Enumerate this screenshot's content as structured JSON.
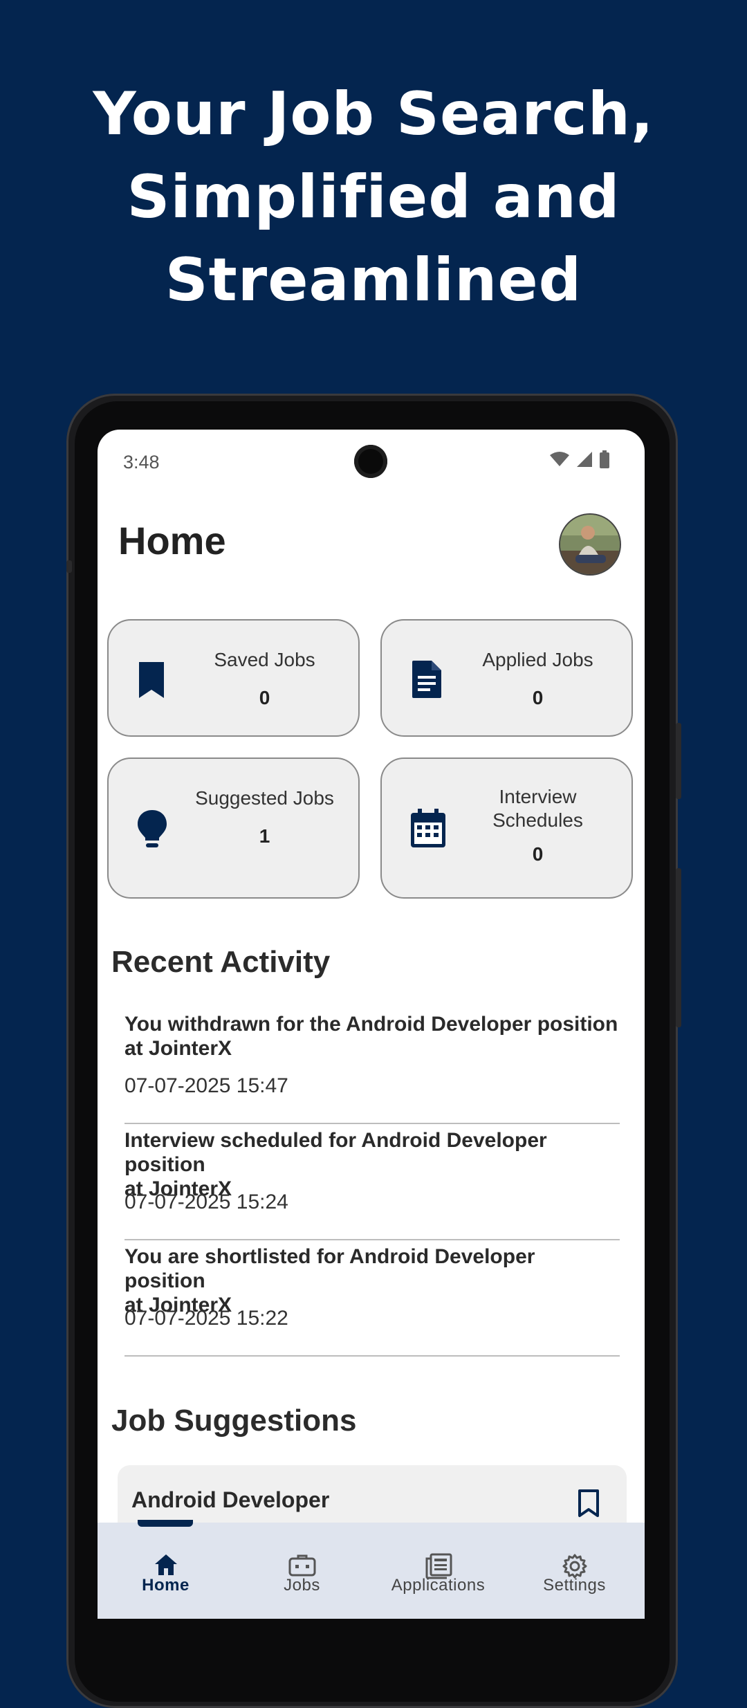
{
  "headline": {
    "line1": "Your Job Search,",
    "line2": "Simplified and",
    "line3": "Streamlined"
  },
  "status_bar": {
    "time": "3:48",
    "icons": [
      "wifi-icon",
      "signal-icon",
      "battery-icon"
    ]
  },
  "page": {
    "title": "Home"
  },
  "stats": [
    {
      "label": "Saved Jobs",
      "count": "0",
      "icon": "bookmark-icon"
    },
    {
      "label": "Applied Jobs",
      "count": "0",
      "icon": "document-icon"
    },
    {
      "label": "Suggested Jobs",
      "count": "1",
      "icon": "lightbulb-icon"
    },
    {
      "label": "Interview Schedules",
      "label_line1": "Interview",
      "label_line2": "Schedules",
      "count": "0",
      "icon": "calendar-icon"
    }
  ],
  "recent_activity": {
    "title": "Recent Activity",
    "items": [
      {
        "line1": "You withdrawn for the Android Developer position",
        "line2": "at JointerX",
        "timestamp": "07-07-2025 15:47"
      },
      {
        "line1": "Interview scheduled for Android Developer position",
        "line2": "at JointerX",
        "timestamp": "07-07-2025 15:24"
      },
      {
        "line1": "You are shortlisted for Android Developer position",
        "line2": "at JointerX",
        "timestamp": "07-07-2025 15:22"
      }
    ]
  },
  "job_suggestions": {
    "title": "Job Suggestions",
    "items": [
      {
        "title": "Android Developer"
      }
    ]
  },
  "bottom_nav": {
    "items": [
      {
        "label": "Home",
        "icon": "home-icon",
        "active": true
      },
      {
        "label": "Jobs",
        "icon": "briefcase-icon",
        "active": false
      },
      {
        "label": "Applications",
        "icon": "newspaper-icon",
        "active": false
      },
      {
        "label": "Settings",
        "icon": "gear-icon",
        "active": false
      }
    ]
  },
  "colors": {
    "background": "#04254f",
    "accent": "#04254f",
    "card_bg": "#efefef",
    "nav_bg": "#dfe4ee"
  }
}
